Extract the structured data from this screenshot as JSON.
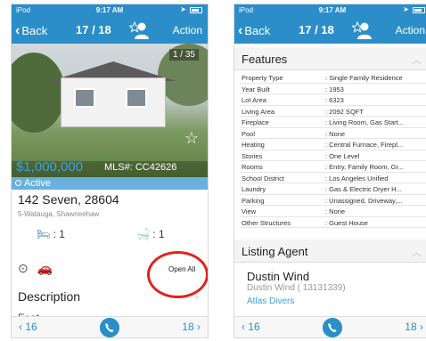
{
  "status_bar": {
    "carrier": "iPod",
    "time": "9:17 AM"
  },
  "nav": {
    "back_label": "Back",
    "pager": "17 / 18",
    "action_label": "Action"
  },
  "listing": {
    "photo_counter": "1 / 35",
    "price": "$1,000,000",
    "mls": "MLS#: CC42626",
    "status": "Active",
    "address": "142 Seven, 28604",
    "area": "5-Watauga, Shawneehaw",
    "beds": ": 1",
    "baths": ": 1",
    "open_all": "Open All",
    "description_label": "Description",
    "partial_label": "Feat"
  },
  "features": {
    "title": "Features",
    "rows": [
      {
        "key": "Property Type",
        "value": ": Single Family Residence"
      },
      {
        "key": "Year Built",
        "value": ": 1953"
      },
      {
        "key": "Lot Area",
        "value": ": 6323"
      },
      {
        "key": "Living Area",
        "value": ": 2092 SQFT"
      },
      {
        "key": "Fireplace",
        "value": ": Living Room, Gas Start..."
      },
      {
        "key": "Pool",
        "value": ": None"
      },
      {
        "key": "Heating",
        "value": ": Central Furnace, Firepl..."
      },
      {
        "key": "Stories",
        "value": ": One Level"
      },
      {
        "key": "Rooms",
        "value": ": Entry, Family Room, Gr..."
      },
      {
        "key": "School District",
        "value": ": Los Angeles Unified"
      },
      {
        "key": "Laundry",
        "value": ": Gas & Electric Dryer H..."
      },
      {
        "key": "Parking",
        "value": ": Unassigned, Driveway,..."
      },
      {
        "key": "View",
        "value": ": None"
      },
      {
        "key": "Other Structures",
        "value": ": Guest House"
      }
    ]
  },
  "agent": {
    "section_title": "Listing Agent",
    "name": "Dustin Wind",
    "id_line": "Dustin Wind ( 13131339)",
    "org": "Atlas Divers"
  },
  "bottom": {
    "prev": "16",
    "next": "18"
  },
  "colors": {
    "brand_blue": "#2b8ec9",
    "highlight_red": "#e2231a",
    "price_blue": "#3aa0e0"
  }
}
